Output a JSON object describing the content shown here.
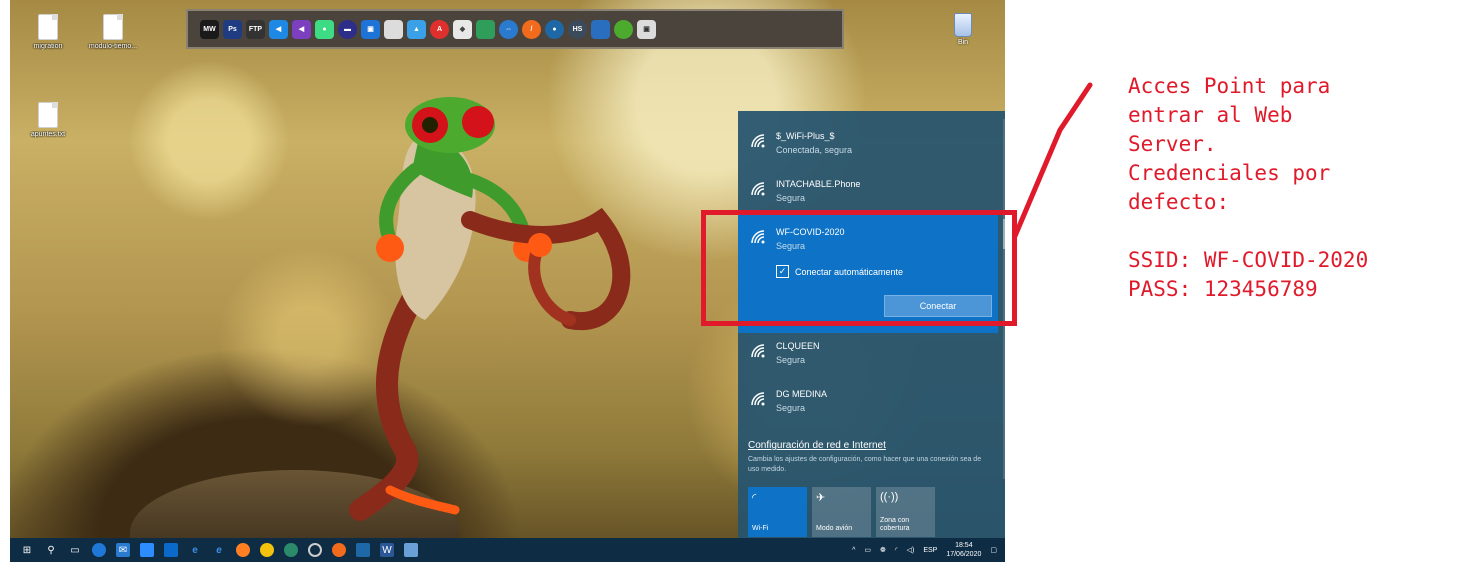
{
  "desktop": {
    "icons": [
      {
        "label": "migration",
        "icon": "folder-icon"
      },
      {
        "label": "modulo-tiemo...",
        "icon": "folder-icon"
      },
      {
        "label": "apuntes.txt",
        "icon": "text-file-icon"
      }
    ],
    "recycle_bin_label": "Bin",
    "dock_icons": [
      "MW",
      "Ps",
      "FTP",
      "VS",
      "VS",
      "AS",
      "",
      "",
      "",
      "",
      "A",
      "",
      "",
      "",
      "",
      "",
      "HS",
      "",
      "",
      ""
    ]
  },
  "wifi_flyout": {
    "networks": [
      {
        "ssid": "$_WiFi-Plus_$",
        "status": "Conectada, segura"
      },
      {
        "ssid": "INTACHABLE.Phone",
        "status": "Segura"
      },
      {
        "ssid": "WF-COVID-2020",
        "status": "Segura",
        "selected": true
      },
      {
        "ssid": "CLQUEEN",
        "status": "Segura"
      },
      {
        "ssid": "DG MEDINA",
        "status": "Segura"
      }
    ],
    "auto_connect_label": "Conectar automáticamente",
    "auto_connect_checked": true,
    "connect_button": "Conectar",
    "settings_link": "Configuración de red e Internet",
    "settings_desc": "Cambia los ajustes de configuración, como hacer que una conexión sea de uso medido.",
    "quick_actions": [
      {
        "label": "Wi-Fi",
        "icon": "wifi-icon",
        "active": true
      },
      {
        "label": "Modo avión",
        "icon": "airplane-icon",
        "active": false
      },
      {
        "label": "Zona con cobertura",
        "icon": "hotspot-icon",
        "active": false
      }
    ]
  },
  "taskbar": {
    "language": "ESP",
    "time": "18:54",
    "date": "17/06/2020"
  },
  "annotation": {
    "text": "Acces Point para\nentrar al Web\nServer.\nCredenciales por\ndefecto:\n\nSSID: WF-COVID-2020\nPASS: 123456789",
    "color": "#e01a2a"
  }
}
